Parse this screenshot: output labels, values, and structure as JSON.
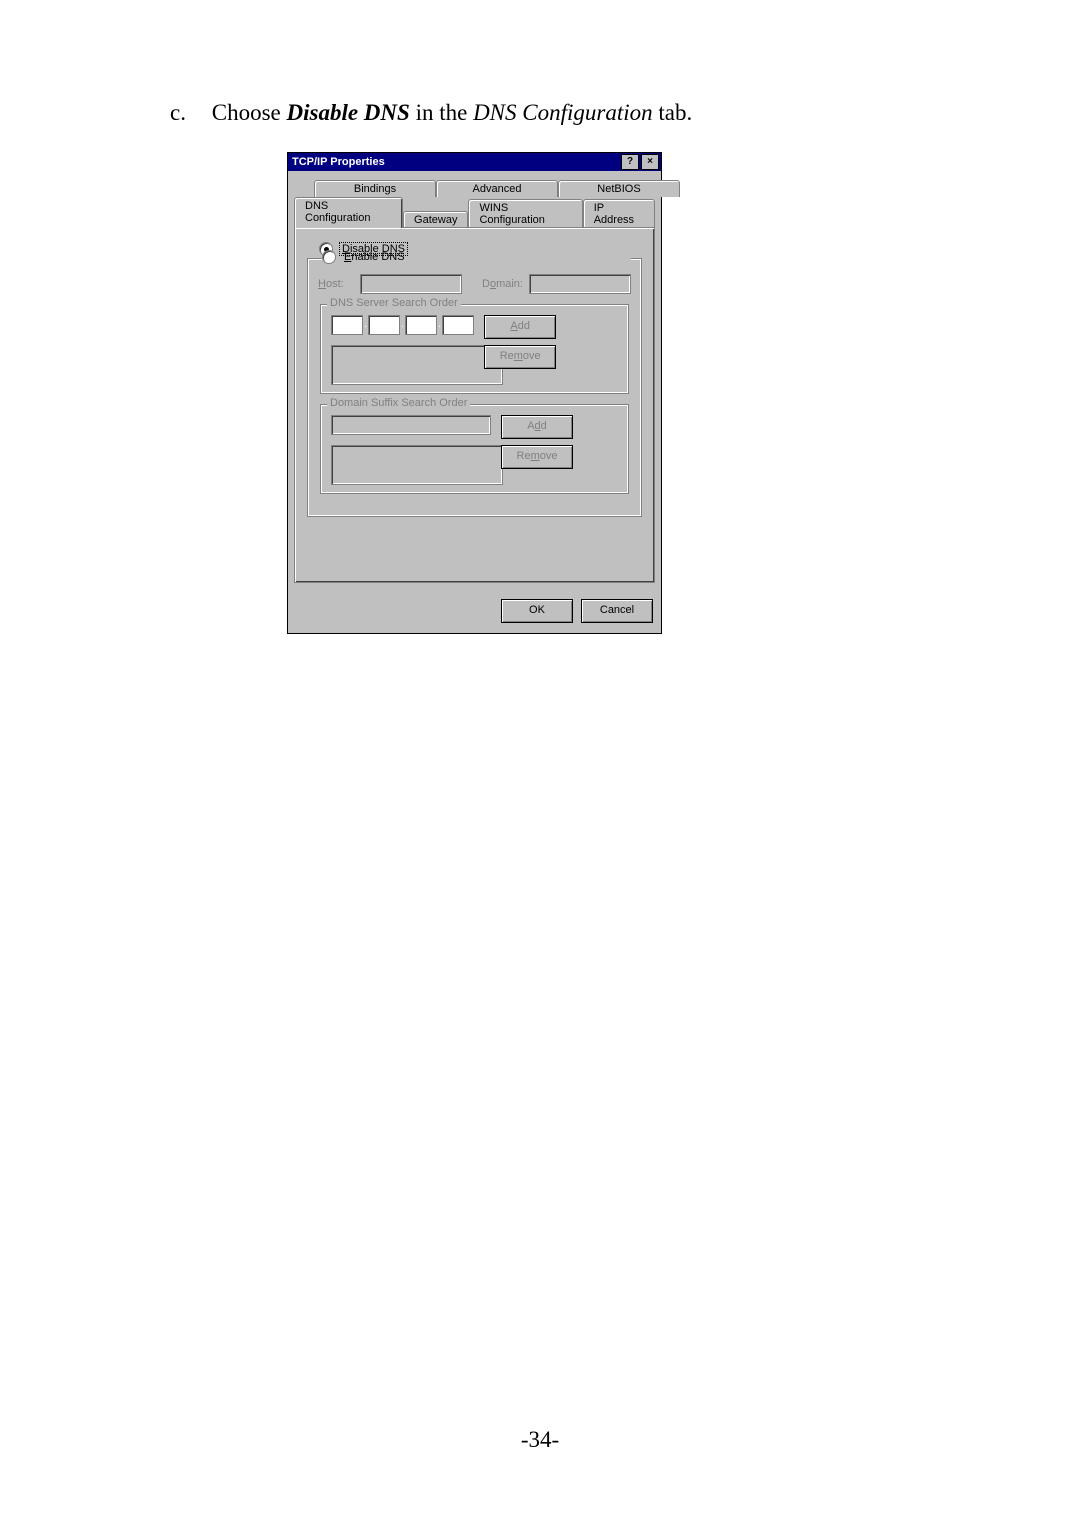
{
  "instruction": {
    "marker": "c.",
    "lead": "Choose ",
    "bold_italic": "Disable DNS",
    "mid": " in the ",
    "italic": "DNS Configuration",
    "tail": " tab."
  },
  "dialog": {
    "title": "TCP/IP Properties",
    "help_glyph": "?",
    "close_glyph": "×",
    "tabs_row1": [
      "Bindings",
      "Advanced",
      "NetBIOS"
    ],
    "tabs_row2": [
      "DNS Configuration",
      "Gateway",
      "WINS Configuration",
      "IP Address"
    ],
    "active_tab": "DNS Configuration",
    "radio_disable": "Disable DNS",
    "radio_enable": "Enable DNS",
    "host_label": "Host:",
    "domain_label": "Domain:",
    "group_dns_server": "DNS Server Search Order",
    "group_domain_suffix": "Domain Suffix Search Order",
    "btn_add": "Add",
    "btn_remove": "Remove",
    "btn_ok": "OK",
    "btn_cancel": "Cancel"
  },
  "page_number": "-34-"
}
